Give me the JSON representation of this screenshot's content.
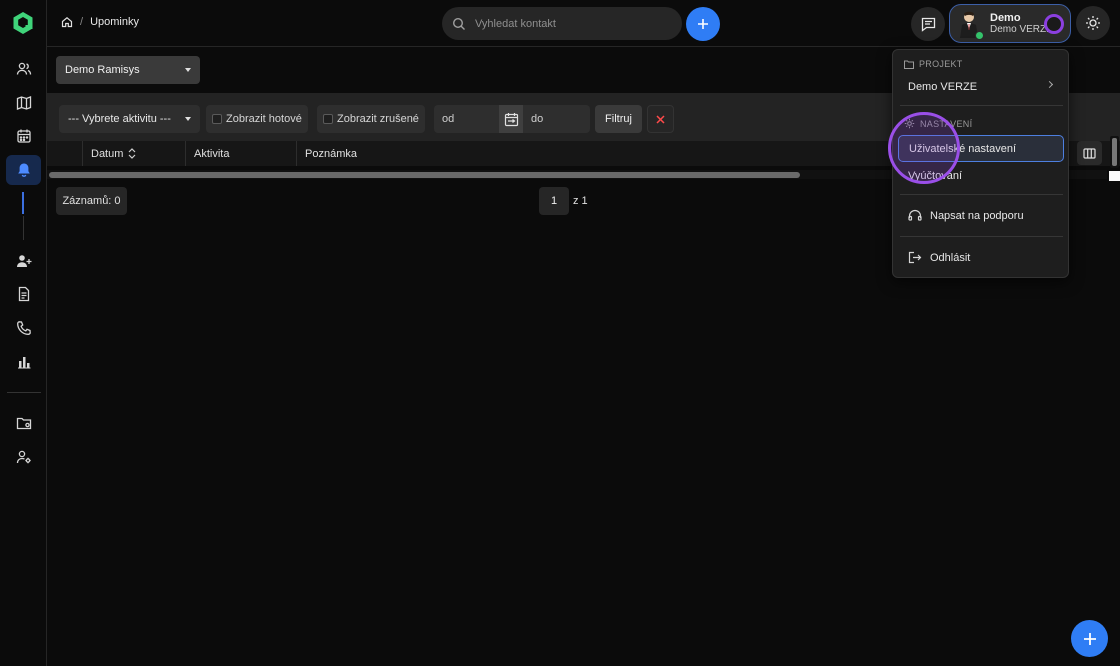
{
  "app": {
    "logo_icon": "app-logo-icon",
    "accent_color": "#2f7df5",
    "active_nav_color": "#4d8bff"
  },
  "sidebar": {
    "items": [
      {
        "id": "contacts",
        "icon": "users-icon"
      },
      {
        "id": "map",
        "icon": "map-icon"
      },
      {
        "id": "calendar",
        "icon": "calendar-icon"
      },
      {
        "id": "reminders",
        "icon": "bell-icon",
        "active": true
      },
      {
        "id": "add-person",
        "icon": "user-add-icon"
      },
      {
        "id": "documents",
        "icon": "document-icon"
      },
      {
        "id": "calls",
        "icon": "phone-icon"
      },
      {
        "id": "stats",
        "icon": "bar-chart-icon"
      },
      {
        "id": "folders",
        "icon": "folder-settings-icon"
      },
      {
        "id": "user-settings",
        "icon": "user-settings-icon"
      }
    ]
  },
  "header": {
    "breadcrumb": {
      "home_icon": "home-icon",
      "separator": "/",
      "current": "Upominky"
    },
    "search": {
      "placeholder": "Vyhledat kontakt"
    },
    "user": {
      "name": "Demo",
      "project": "Demo VERZE",
      "status_color": "#34c36b"
    }
  },
  "project_select": {
    "value": "Demo Ramisys"
  },
  "filters": {
    "activity_select": "--- Vybrete aktivitu ---",
    "show_done": "Zobrazit hotové",
    "show_cancelled": "Zobrazit zrušené",
    "from_placeholder": "od",
    "to_placeholder": "do",
    "filter_button": "Filtruj"
  },
  "table": {
    "columns": [
      "Datum",
      "Aktivita",
      "Poznámka"
    ]
  },
  "pagination": {
    "records": "Záznamů: 0",
    "page": "1",
    "of": "z 1"
  },
  "user_menu": {
    "project_section": "PROJEKT",
    "project_name": "Demo VERZE",
    "settings_section": "NASTAVENÍ",
    "items": {
      "user_settings": "Uživatelské nastavení",
      "billing": "Vyúčtování",
      "support": "Napsat na podporu",
      "logout": "Odhlásit"
    }
  }
}
